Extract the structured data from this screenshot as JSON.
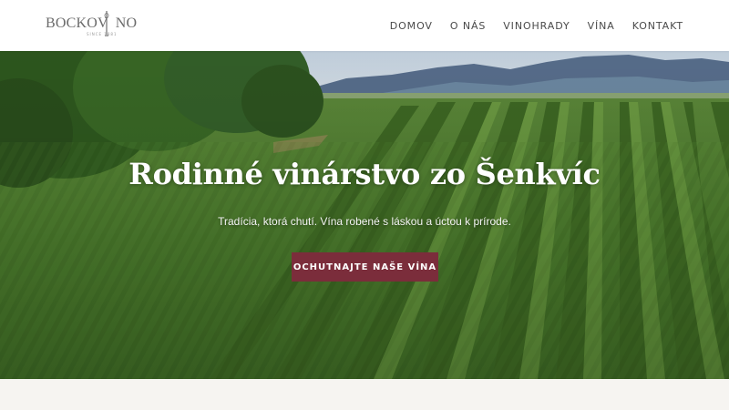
{
  "header": {
    "logo_text": "BOCKOVINO",
    "logo_text_left": "BOCKOV",
    "logo_text_right": "NO",
    "logo_subtext": "SINCE 1881",
    "nav": [
      {
        "label": "DOMOV"
      },
      {
        "label": "O NÁS"
      },
      {
        "label": "VINOHRADY"
      },
      {
        "label": "VÍNA"
      },
      {
        "label": "KONTAKT"
      }
    ]
  },
  "hero": {
    "title": "Rodinné vinárstvo zo Šenkvíc",
    "subtitle": "Tradícia, ktorá chutí. Vína robené s láskou a úctou k prírode.",
    "cta_label": "OCHUTNAJTE NAŠE VÍNA"
  },
  "colors": {
    "accent": "#7b2d3b",
    "header_bg": "#ffffff",
    "nav_text": "#4a4a4a",
    "section_bg": "#f6f4f1"
  }
}
